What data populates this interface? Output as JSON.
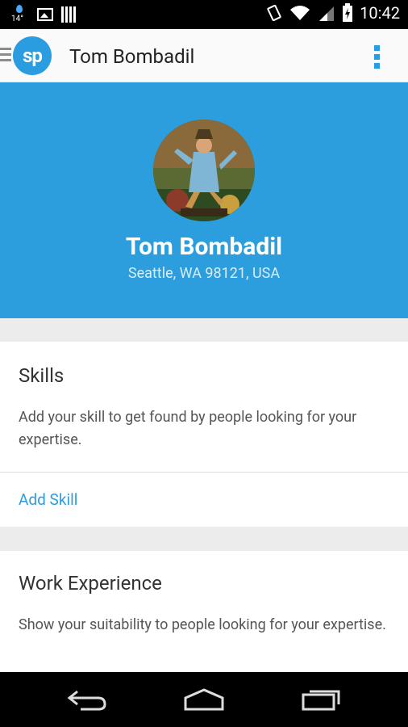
{
  "status_bar": {
    "temperature": "14°",
    "time": "10:42"
  },
  "app_bar": {
    "logo_text": "sp",
    "title": "Tom Bombadil"
  },
  "profile": {
    "name": "Tom Bombadil",
    "location": "Seattle, WA 98121, USA"
  },
  "skills": {
    "title": "Skills",
    "description": "Add your skill to get found by people looking for your expertise.",
    "action": "Add Skill"
  },
  "work_experience": {
    "title": "Work Experience",
    "description": "Show your suitability to people looking for your expertise."
  },
  "colors": {
    "brand_blue": "#2c9ede",
    "link_blue": "#2a9de0"
  }
}
